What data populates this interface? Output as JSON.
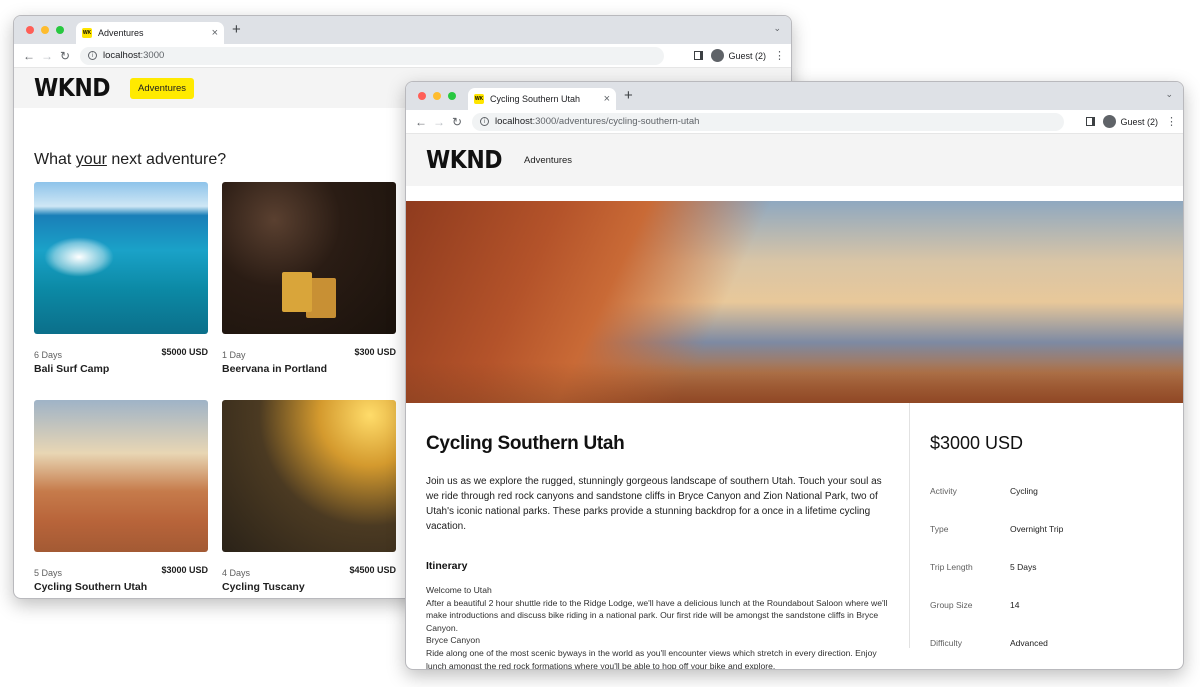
{
  "back_window": {
    "tab_title": "Adventures",
    "favicon_text": "WK",
    "url_host": "localhost",
    "url_path": ":3000",
    "profile_label": "Guest (2)",
    "logo": "WKND",
    "nav_label": "Adventures",
    "heading_pre": "What ",
    "heading_emph": "your",
    "heading_post": " next adventure?",
    "cards": [
      {
        "days": "6 Days",
        "price": "$5000 USD",
        "name": "Bali Surf Camp",
        "image": "surf-photo"
      },
      {
        "days": "1 Day",
        "price": "$300 USD",
        "name": "Beervana in Portland",
        "image": "beer-photo"
      },
      {
        "days": "5 Days",
        "price": "$3000 USD",
        "name": "Cycling Southern Utah",
        "image": "utah-photo"
      },
      {
        "days": "4 Days",
        "price": "$4500 USD",
        "name": "Cycling Tuscany",
        "image": "tuscany-photo"
      }
    ]
  },
  "front_window": {
    "tab_title": "Cycling Southern Utah",
    "favicon_text": "WK",
    "url_host": "localhost",
    "url_path": ":3000/adventures/cycling-southern-utah",
    "profile_label": "Guest (2)",
    "logo": "WKND",
    "nav_label": "Adventures",
    "title": "Cycling Southern Utah",
    "description": "Join us as we explore the rugged, stunningly gorgeous landscape of southern Utah. Touch your soul as we ride through red rock canyons and sandstone cliffs in Bryce Canyon and Zion National Park, two of Utah's iconic national parks. These parks provide a stunning backdrop for a once in a lifetime cycling vacation.",
    "itinerary_heading": "Itinerary",
    "itinerary": [
      "Welcome to Utah",
      "After a beautiful 2 hour shuttle ride to the Ridge Lodge, we'll have a delicious lunch at the Roundabout Saloon where we'll make introductions and discuss bike riding in a national park. Our first ride will be amongst the sandstone cliffs in Bryce Canyon.",
      "Bryce Canyon",
      "Ride along one of the most scenic byways in the world as you'll encounter views which stretch in every direction. Enjoy lunch amongst the red rock formations where you'll be able to hop off your bike and explore."
    ],
    "price": "$3000 USD",
    "facts": [
      {
        "label": "Activity",
        "value": "Cycling"
      },
      {
        "label": "Type",
        "value": "Overnight Trip"
      },
      {
        "label": "Trip Length",
        "value": "5 Days"
      },
      {
        "label": "Group Size",
        "value": "14"
      },
      {
        "label": "Difficulty",
        "value": "Advanced"
      }
    ]
  },
  "icons": {
    "close": "×",
    "new_tab": "+",
    "back": "←",
    "forward": "→",
    "reload": "↻",
    "kebab": "⋮",
    "chevron": "⌄"
  },
  "colors": {
    "brand_yellow": "#ffea00",
    "tabstrip": "#dee1e6",
    "header_bg": "#f4f4f4"
  }
}
